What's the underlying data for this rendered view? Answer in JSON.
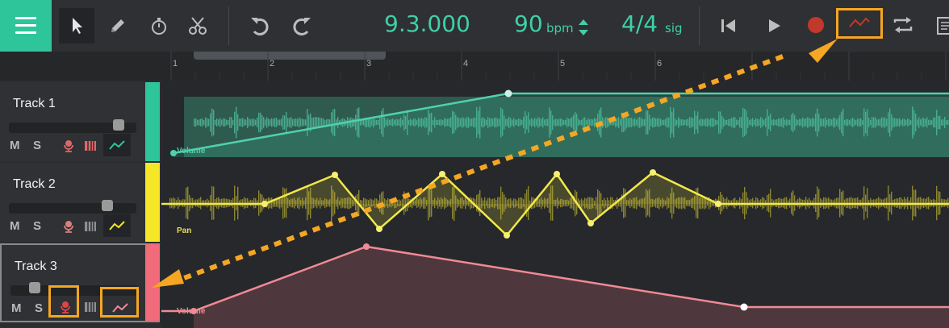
{
  "toolbar": {
    "tools": [
      "menu-icon",
      "pointer-icon",
      "pencil-icon",
      "stopwatch-icon",
      "scissors-icon"
    ],
    "history": [
      "undo-icon",
      "redo-icon"
    ],
    "position": "9.3.000",
    "tempo_value": "90",
    "tempo_unit": "bpm",
    "time_signature": "4/4",
    "time_signature_unit": "sig",
    "transport": [
      "skip-to-start-icon",
      "play-icon",
      "record-icon",
      "automation-icon",
      "loop-icon",
      "notes-icon"
    ]
  },
  "ruler": {
    "bars": [
      "1",
      "2",
      "3",
      "4",
      "5",
      "6"
    ],
    "loop_start_bar": 1.25,
    "loop_end_bar": 3.2
  },
  "tracks": [
    {
      "name": "Track 1",
      "color": "#2fc59a",
      "mute": "M",
      "solo": "S",
      "volume": 0.9,
      "lane": {
        "label": "Volume",
        "param": "volume",
        "color": "#4fd1ad"
      }
    },
    {
      "name": "Track 2",
      "color": "#f5e627",
      "mute": "M",
      "solo": "S",
      "volume": 0.8,
      "lane": {
        "label": "Pan",
        "param": "pan",
        "color": "#e8dd55"
      }
    },
    {
      "name": "Track 3",
      "color": "#f26b7a",
      "mute": "M",
      "solo": "S",
      "volume": 0.2,
      "lane": {
        "label": "Volume",
        "param": "volume",
        "color": "#f08a95"
      }
    }
  ],
  "colors": {
    "accent": "#2fc59a",
    "highlight": "#f5a623",
    "display": "#3fd0a6",
    "record": "#c0392b"
  }
}
